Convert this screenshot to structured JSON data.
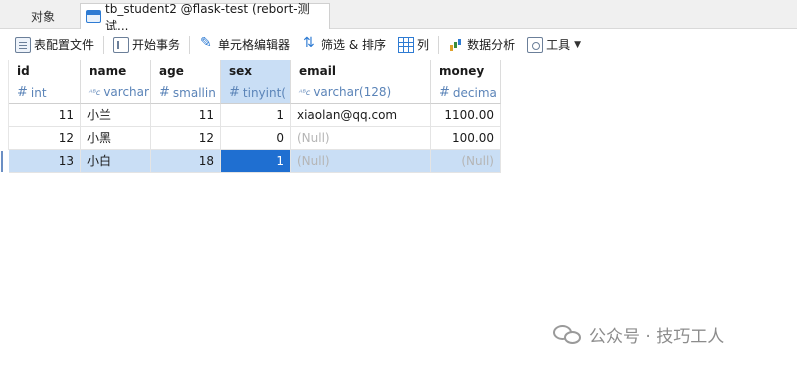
{
  "tabs": [
    {
      "label": "对象"
    },
    {
      "label": "tb_student2 @flask-test (rebort-测试..."
    }
  ],
  "toolbar": {
    "config_label": "表配置文件",
    "transaction_label": "开始事务",
    "cell_editor_label": "单元格编辑器",
    "filter_sort_label": "筛选 & 排序",
    "columns_label": "列",
    "data_analysis_label": "数据分析",
    "tools_label": "工具"
  },
  "columns": [
    {
      "name": "id",
      "type": "int",
      "type_icon": "#"
    },
    {
      "name": "name",
      "type": "varchar",
      "type_icon": "ᴬᴮc"
    },
    {
      "name": "age",
      "type": "smallin",
      "type_icon": "#"
    },
    {
      "name": "sex",
      "type": "tinyint(",
      "type_icon": "#"
    },
    {
      "name": "email",
      "type": "varchar(128)",
      "type_icon": "ᴬᴮc"
    },
    {
      "name": "money",
      "type": "decima",
      "type_icon": "#"
    }
  ],
  "rows": [
    [
      "11",
      "小兰",
      "11",
      "1",
      "xiaolan@qq.com",
      "1100.00"
    ],
    [
      "12",
      "小黑",
      "12",
      "0",
      "(Null)",
      "100.00"
    ],
    [
      "13",
      "小白",
      "18",
      "1",
      "(Null)",
      "(Null)"
    ]
  ],
  "watermark": "公众号 · 技巧工人",
  "colors": {
    "selection": "#c9def5",
    "focus_cell": "#1f6fd1",
    "type_text": "#5b84b8",
    "null_text": "#b5b5b5"
  }
}
